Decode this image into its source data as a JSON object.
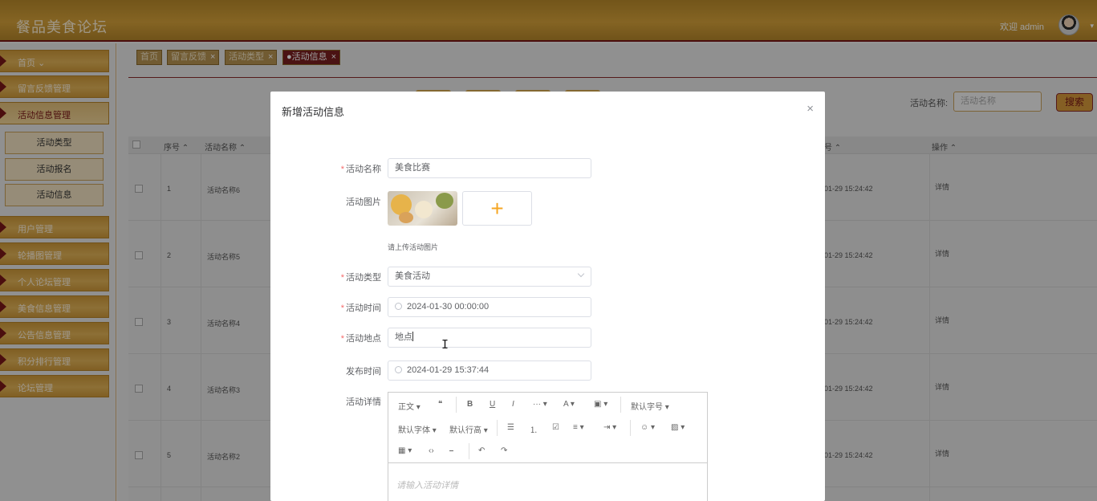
{
  "header": {
    "app_title": "餐品美食论坛",
    "welcome": "欢迎 admin",
    "avatar_icon": "user-avatar-icon"
  },
  "sidebar": {
    "items": [
      {
        "label": "首页",
        "suffix": "⌄"
      },
      {
        "label": "留言反馈管理"
      },
      {
        "label": "活动信息管理"
      },
      {
        "label": "用户管理"
      },
      {
        "label": "轮播图管理"
      },
      {
        "label": "个人论坛管理"
      },
      {
        "label": "美食信息管理"
      },
      {
        "label": "公告信息管理"
      },
      {
        "label": "积分排行管理"
      },
      {
        "label": "论坛管理"
      }
    ],
    "subitems": [
      {
        "label": "活动类型"
      },
      {
        "label": "活动报名"
      },
      {
        "label": "活动信息"
      }
    ]
  },
  "tabs": [
    {
      "label": "首页",
      "close": ""
    },
    {
      "label": "留言反馈",
      "close": "×"
    },
    {
      "label": "活动类型",
      "close": "×"
    },
    {
      "label": "●活动信息",
      "close": "×"
    }
  ],
  "search": {
    "label": "活动名称:",
    "placeholder": "活动名称",
    "button": "搜索"
  },
  "table": {
    "headers": {
      "index": "序号 ⌃",
      "name": "活动名称 ⌃",
      "time": "号 ⌃",
      "action": "操作 ⌃"
    },
    "rows": [
      {
        "index": "1",
        "name": "活动名称6",
        "time": "01-29 15:24:42",
        "action": "详情"
      },
      {
        "index": "2",
        "name": "活动名称5",
        "time": "01-29 15:24:42",
        "action": "详情"
      },
      {
        "index": "3",
        "name": "活动名称4",
        "time": "01-29 15:24:42",
        "action": "详情"
      },
      {
        "index": "4",
        "name": "活动名称3",
        "time": "01-29 15:24:42",
        "action": "详情"
      },
      {
        "index": "5",
        "name": "活动名称2",
        "time": "01-29 15:24:42",
        "action": "详情"
      }
    ]
  },
  "modal": {
    "title": "新增活动信息",
    "close": "×",
    "fields": {
      "name": {
        "label": "活动名称",
        "value": "美食比赛"
      },
      "image": {
        "label": "活动图片",
        "hint": "请上传活动图片",
        "upload_symbol": "+"
      },
      "type": {
        "label": "活动类型",
        "value": "美食活动"
      },
      "time": {
        "label": "活动时间",
        "value": "2024-01-30 00:00:00"
      },
      "place": {
        "label": "活动地点",
        "value": "地点"
      },
      "publish": {
        "label": "发布时间",
        "value": "2024-01-29 15:37:44"
      },
      "detail": {
        "label": "活动详情",
        "placeholder": "请输入活动详情"
      }
    },
    "editor_toolbar": {
      "row1": [
        "正文 ▾",
        "❝",
        "B",
        "U",
        "I",
        "··· ▾",
        "A ▾",
        "▣ ▾",
        "默认字号 ▾"
      ],
      "row2": [
        "默认字体 ▾",
        "默认行高 ▾",
        "☰",
        "⒈",
        "☑",
        "≡ ▾",
        "⇥ ▾",
        "☺ ▾",
        "▨ ▾"
      ],
      "row3": [
        "▦ ▾",
        "‹›",
        "⎯",
        "↶",
        "↷"
      ]
    }
  }
}
